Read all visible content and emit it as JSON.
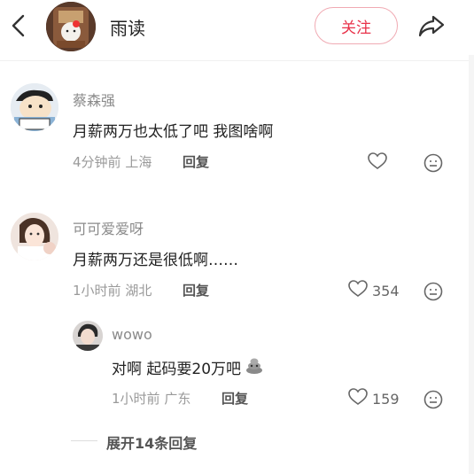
{
  "header": {
    "title": "雨读",
    "follow_label": "关注"
  },
  "comments": [
    {
      "user": "蔡森强",
      "text": "月薪两万也太低了吧  我图啥啊",
      "time": "4分钟前",
      "location": "上海",
      "reply_label": "回复",
      "likes": ""
    },
    {
      "user": "可可爱爱呀",
      "text": "月薪两万还是很低啊……",
      "time": "1小时前",
      "location": "湖北",
      "reply_label": "回复",
      "likes": "354",
      "replies": [
        {
          "user": "wowo",
          "text": "对啊 起码要20万吧",
          "time": "1小时前",
          "location": "广东",
          "reply_label": "回复",
          "likes": "159"
        }
      ]
    }
  ],
  "expand_label": "展开14条回复",
  "colors": {
    "accent": "#e8324a",
    "follow_border": "#f0aab3"
  }
}
